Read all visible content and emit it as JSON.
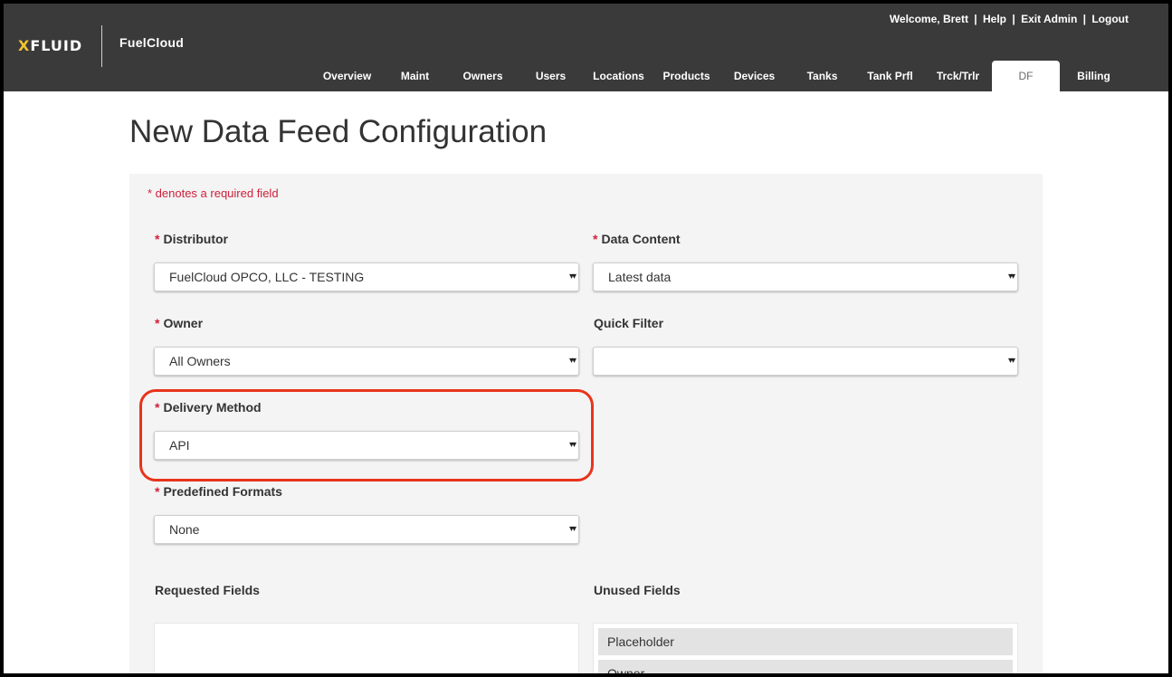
{
  "header": {
    "logo_x": "X",
    "logo_rest": "FLUID",
    "brand": "FuelCloud",
    "links": {
      "welcome": "Welcome, Brett",
      "sep": "|",
      "help": "Help",
      "exit_admin": "Exit Admin",
      "logout": "Logout"
    },
    "tabs": [
      {
        "label": "Overview"
      },
      {
        "label": "Maint"
      },
      {
        "label": "Owners"
      },
      {
        "label": "Users"
      },
      {
        "label": "Locations"
      },
      {
        "label": "Products"
      },
      {
        "label": "Devices"
      },
      {
        "label": "Tanks"
      },
      {
        "label": "Tank Prfl"
      },
      {
        "label": "Trck/Trlr"
      },
      {
        "label": "DF"
      },
      {
        "label": "Billing"
      }
    ],
    "active_tab": "DF"
  },
  "page": {
    "title": "New Data Feed Configuration",
    "required_note": "* denotes a required field"
  },
  "form": {
    "star": "*",
    "arrow": "▾▾",
    "distributor": {
      "label": "Distributor",
      "value": "FuelCloud OPCO, LLC - TESTING"
    },
    "data_content": {
      "label": "Data Content",
      "value": "Latest data"
    },
    "owner": {
      "label": "Owner",
      "value": "All Owners"
    },
    "quick_filter": {
      "label": "Quick Filter",
      "value": ""
    },
    "delivery_method": {
      "label": "Delivery Method",
      "value": "API"
    },
    "predefined_formats": {
      "label": "Predefined Formats",
      "value": "None"
    },
    "requested_fields": {
      "label": "Requested Fields",
      "items": []
    },
    "unused_fields": {
      "label": "Unused Fields",
      "items": [
        "Placeholder",
        "Owner"
      ]
    }
  },
  "colors": {
    "header_bg": "#3a3a3a",
    "logo_accent": "#f2c230",
    "required_red": "#d0203a",
    "highlight_red": "#e8341c",
    "panel_bg": "#f4f4f4"
  }
}
